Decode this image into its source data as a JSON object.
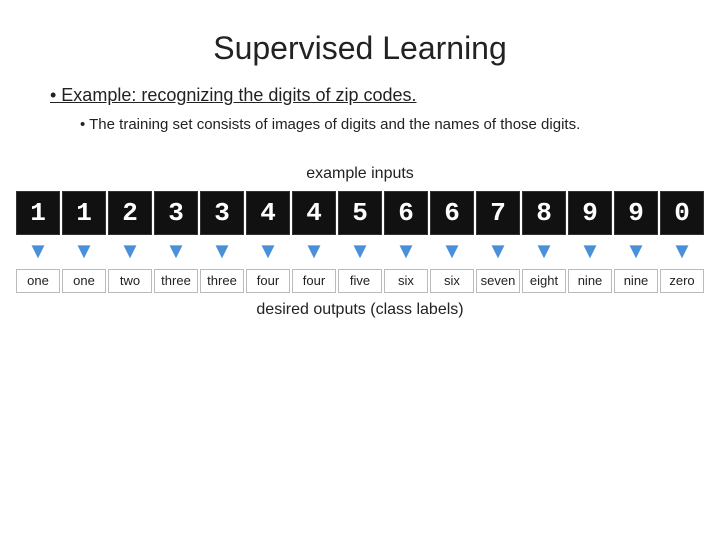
{
  "title": "Supervised Learning",
  "bullet_main": "• Example: recognizing the digits of zip codes.",
  "bullet_sub": "• The training set consists of images of digits and the names of those digits.",
  "example_inputs_label": "example inputs",
  "desired_outputs_label": "desired outputs (class labels)",
  "digits": [
    "1",
    "1",
    "2",
    "3",
    "3",
    "4",
    "4",
    "5",
    "6",
    "6",
    "7",
    "8",
    "9",
    "9",
    "0"
  ],
  "labels": [
    "one",
    "one",
    "two",
    "three",
    "three",
    "four",
    "four",
    "five",
    "six",
    "six",
    "seven",
    "eight",
    "nine",
    "nine",
    "zero"
  ],
  "arrow_char": "▼"
}
